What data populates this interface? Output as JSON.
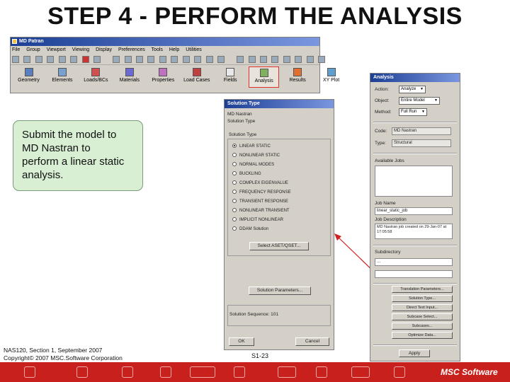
{
  "slide": {
    "title": "STEP 4 - PERFORM THE ANALYSIS",
    "callout": [
      "Submit the model to",
      "MD Nastran to",
      "perform a linear static",
      "analysis."
    ],
    "footer_line1": "NAS120, Section 1, September 2007",
    "footer_line2": "Copyright© 2007 MSC.Software Corporation",
    "page_number": "S1-23",
    "brand": "MSC Software",
    "colors": {
      "footer_red": "#c8201c",
      "callout_green": "#d8efd4",
      "window_titlebar": "#1c3f94"
    }
  },
  "patran": {
    "window_title": "MD Patran",
    "menu": [
      "File",
      "Group",
      "Viewport",
      "Viewing",
      "Display",
      "Preferences",
      "Tools",
      "Help",
      "Utilities"
    ],
    "apps": [
      "Geometry",
      "Elements",
      "Loads/BCs",
      "Materials",
      "Properties",
      "Load Cases",
      "Fields",
      "Analysis",
      "Results",
      "XY Plot"
    ],
    "active_app": "Analysis"
  },
  "solution_dialog": {
    "title": "Solution Type",
    "header_line1": "MD Nastran",
    "header_line2": "Solution Type",
    "group_label": "Solution Type",
    "options": [
      "LINEAR STATIC",
      "NONLINEAR STATIC",
      "NORMAL MODES",
      "BUCKLING",
      "COMPLEX EIGENVALUE",
      "FREQUENCY RESPONSE",
      "TRANSIENT RESPONSE",
      "NONLINEAR TRANSIENT",
      "IMPLICIT NONLINEAR",
      "DDAM Solution"
    ],
    "selected_index": 0,
    "select_aset_button": "Select ASET/QSET...",
    "solution_params_button": "Solution Parameters...",
    "sequence_label": "Solution Sequence: 101",
    "ok_button": "OK",
    "cancel_button": "Cancel"
  },
  "analysis_panel": {
    "title": "Analysis",
    "action_label": "Action:",
    "action_value": "Analyze",
    "object_label": "Object:",
    "object_value": "Entire Model",
    "method_label": "Method:",
    "method_value": "Full Run",
    "code_label": "Code:",
    "code_value": "MD Nastran",
    "type_label": "Type:",
    "type_value": "Structural",
    "available_jobs_label": "Available Jobs",
    "job_name_label": "Job Name",
    "job_name_value": "linear_static_job",
    "job_description_label": "Job Description",
    "job_description_value": "MD Nastran job created on 29-Jan-07 at 17:05:58",
    "subdirectory_label": "Subdirectory",
    "subdirectory_value": "...",
    "buttons": [
      "Translation Parameters...",
      "Solution Type...",
      "Direct Text Input...",
      "Subcase Select...",
      "Subcases...",
      "Optimize Data..."
    ],
    "apply_button": "Apply"
  }
}
